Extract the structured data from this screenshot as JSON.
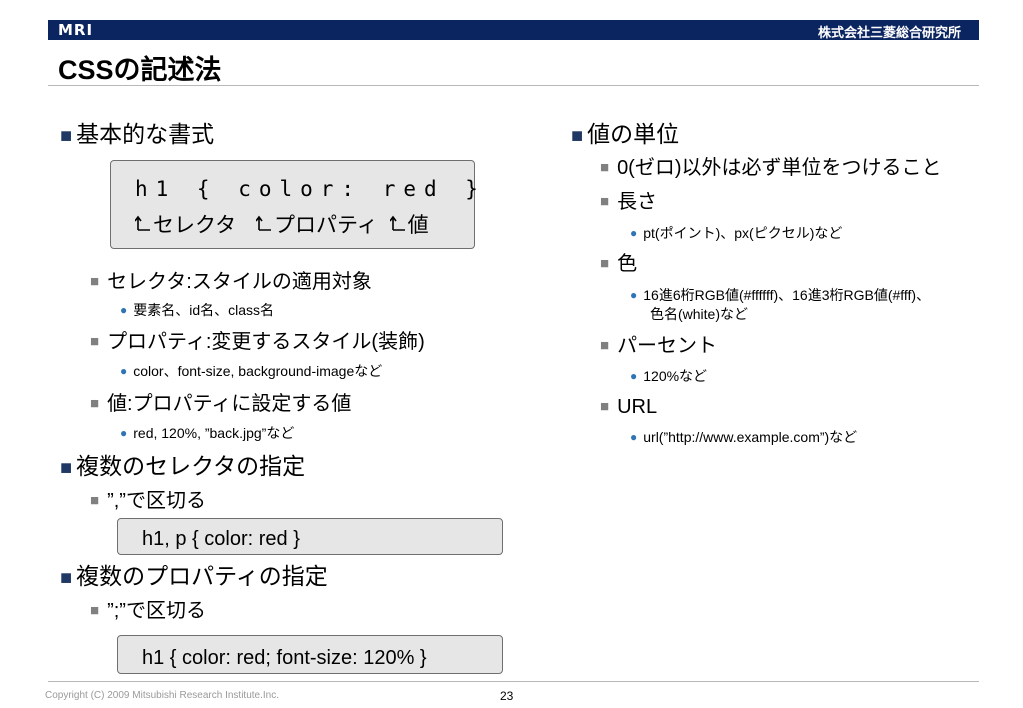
{
  "header": {
    "logo": "MRI",
    "company": "株式会社三菱総合研究所"
  },
  "title": "CSSの記述法",
  "left": {
    "h_format": "基本的な書式",
    "code_line": "h1 { color: red }",
    "code_sub": {
      "selector": "セレクタ",
      "property": "プロパティ",
      "value": "値"
    },
    "selector_item": "セレクタ:スタイルの適用対象",
    "selector_sub": "要素名、id名、class名",
    "property_item": "プロパティ:変更するスタイル(装飾)",
    "property_sub": "color、font-size, background-imageなど",
    "value_item": "値:プロパティに設定する値",
    "value_sub": "red, 120%, ”back.jpg”など",
    "h_multi_selector": "複数のセレクタの指定",
    "comma_item": "”,”で区切る",
    "comma_code": "h1, p { color: red }",
    "h_multi_property": "複数のプロパティの指定",
    "semicolon_item": "”;”で区切る",
    "semicolon_code": "h1 { color: red; font-size: 120% }"
  },
  "right": {
    "h_units": "値の単位",
    "zero_item": "0(ゼロ)以外は必ず単位をつけること",
    "length_item": "長さ",
    "length_sub": "pt(ポイント)、px(ピクセル)など",
    "color_item": "色",
    "color_sub_1": "16進6桁RGB値(#ffffff)、16進3桁RGB値(#fff)、",
    "color_sub_2": "色名(white)など",
    "percent_item": "パーセント",
    "percent_sub": "120%など",
    "url_item": "URL",
    "url_sub": "url(”http://www.example.com”)など"
  },
  "footer": {
    "copyright": "Copyright (C) 2009 Mitsubishi Research Institute.Inc.",
    "page": "23"
  }
}
